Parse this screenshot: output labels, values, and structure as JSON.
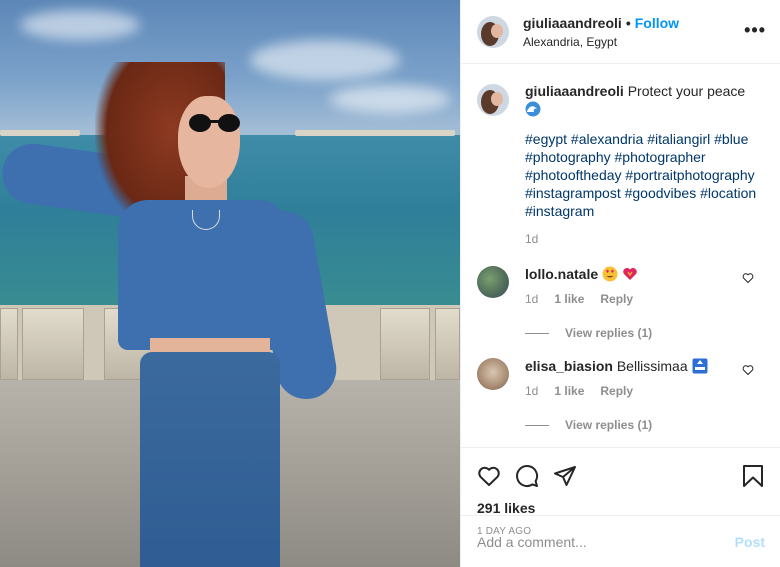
{
  "header": {
    "username": "giuliaaandreoli",
    "dot": "•",
    "follow_label": "Follow",
    "location": "Alexandria, Egypt",
    "more_label": "•••"
  },
  "caption": {
    "username": "giuliaaandreoli",
    "text": "Protect your peace",
    "emoji_icon": "wave-emoji",
    "hashtags": "#egypt #alexandria #italiangirl #blue #photography #photographer #photooftheday #portraitphotography #instagrampost #goodvibes #location #instagram",
    "time": "1d"
  },
  "comments": [
    {
      "username": "lollo.natale",
      "text": "",
      "emoji_icons": [
        "heart-eyes-emoji",
        "sparkling-heart-emoji"
      ],
      "time": "1d",
      "likes": "1 like",
      "reply_label": "Reply",
      "view_replies": "View replies (1)"
    },
    {
      "username": "elisa_biasion",
      "text": "Bellissimaa",
      "emoji_icons": [
        "top-emoji"
      ],
      "time": "1d",
      "likes": "1 like",
      "reply_label": "Reply",
      "view_replies": "View replies (1)"
    }
  ],
  "actions": {
    "likes": "291 likes",
    "ago": "1 DAY AGO"
  },
  "add_comment": {
    "placeholder": "Add a comment...",
    "post_label": "Post"
  },
  "colors": {
    "link_blue": "#0095f6",
    "hashtag": "#00376b",
    "muted": "#8e8e8e",
    "post_disabled": "#b2dffc"
  }
}
